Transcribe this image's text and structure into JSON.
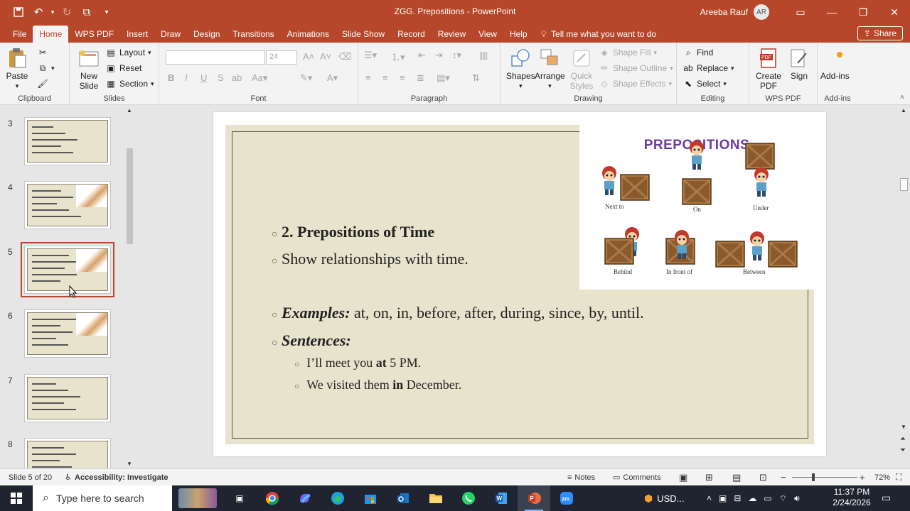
{
  "window": {
    "title": "ZGG. Prepositions  -  PowerPoint",
    "user": "Areeba Rauf",
    "initials": "AR"
  },
  "colors": {
    "accent": "#b7472a",
    "slide_bg": "#e7e3cd",
    "picture_title": "#6b3a9e"
  },
  "tabs": [
    "File",
    "Home",
    "WPS PDF",
    "Insert",
    "Draw",
    "Design",
    "Transitions",
    "Animations",
    "Slide Show",
    "Record",
    "Review",
    "View",
    "Help"
  ],
  "active_tab": "Home",
  "tellme": "Tell me what you want to do",
  "share_label": "Share",
  "ribbon": {
    "clipboard": {
      "label": "Clipboard",
      "paste": "Paste"
    },
    "slides": {
      "label": "Slides",
      "new_slide": "New Slide",
      "layout": "Layout",
      "reset": "Reset",
      "section": "Section"
    },
    "font": {
      "label": "Font",
      "size": "24"
    },
    "paragraph": {
      "label": "Paragraph"
    },
    "drawing": {
      "label": "Drawing",
      "shapes": "Shapes",
      "arrange": "Arrange",
      "quick_styles": "Quick Styles",
      "fill": "Shape Fill",
      "outline": "Shape Outline",
      "effects": "Shape Effects"
    },
    "editing": {
      "label": "Editing",
      "find": "Find",
      "replace": "Replace",
      "select": "Select"
    },
    "wps": {
      "label": "WPS PDF",
      "create": "Create PDF",
      "sign": "Sign"
    },
    "addins": {
      "label": "Add-ins",
      "addins": "Add-ins"
    }
  },
  "thumbnails": [
    {
      "num": "3",
      "selected": false
    },
    {
      "num": "4",
      "selected": false
    },
    {
      "num": "5",
      "selected": true
    },
    {
      "num": "6",
      "selected": false
    },
    {
      "num": "7",
      "selected": false
    },
    {
      "num": "8",
      "selected": false
    }
  ],
  "slide": {
    "heading": "2. Prepositions of Time",
    "subheading": "Show relationships with time.",
    "examples_label": "Examples:",
    "examples_text": " at, on, in, before, after, during, since, by, until.",
    "sentences_label": "Sentences:",
    "sentence1_a": "I’ll meet you ",
    "sentence1_b": "at",
    "sentence1_c": " 5 PM.",
    "sentence2_a": "We visited them ",
    "sentence2_b": "in",
    "sentence2_c": " December."
  },
  "picture": {
    "title": "PREPOSITIONS",
    "labels": [
      "Next to",
      "On",
      "Under",
      "Behind",
      "In front of",
      "Between"
    ]
  },
  "status": {
    "slide_of": "Slide 5 of 20",
    "accessibility": "Accessibility: Investigate",
    "notes": "Notes",
    "comments": "Comments",
    "zoom": "72%"
  },
  "taskbar": {
    "search_placeholder": "Type here to search",
    "currency": "USD...",
    "time": "11:37 PM",
    "date": "2/24/2026"
  }
}
